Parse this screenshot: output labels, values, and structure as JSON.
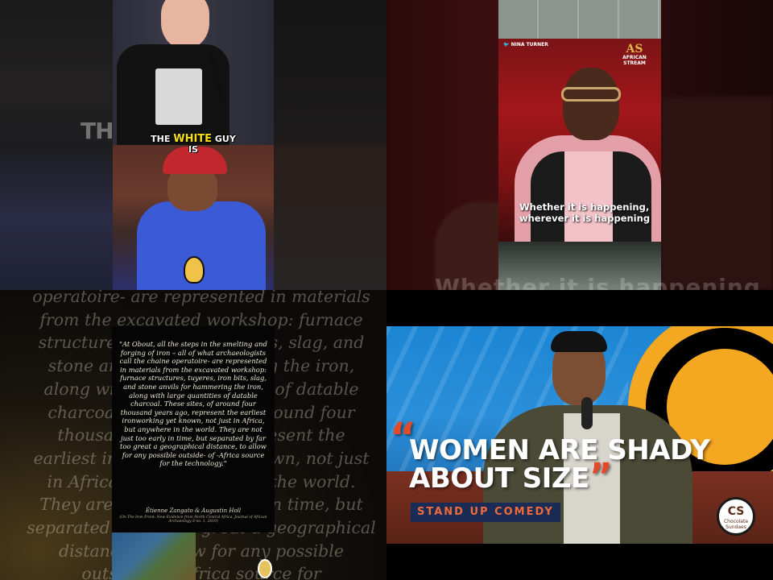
{
  "top_left": {
    "ghost_text": "THE WHITE GUY",
    "caption_line1_pre": "THE",
    "caption_highlight": "WHITE",
    "caption_line1_post": "GUY",
    "caption_line2": "IS"
  },
  "top_right": {
    "credit": "NINA TURNER",
    "logo_mark": "AS",
    "logo_line1": "AFRICAN",
    "logo_line2": "STREAM",
    "caption": "Whether it is happening, wherever it is happening",
    "ghost_caption": "Whether it is happening"
  },
  "bottom_left": {
    "ghost_text": "operatoire- are represented in materials from the excavated workshop: furnace structures, tuyeres, iron bits, slag, and stone anvils for hammering the iron, along with large quantities of datable charcoal. These sites, of around four thousand years ago, represent the earliest ironworking yet known, not just in Africa, but anywhere in the world. They are not just too early in time, but separated by far too great a geographical distance, to allow for any possible outside- of -Africa source for",
    "quote": "\"At Obout, all the steps in the smelting and forging of iron – all of what archaeologists call the chaine operatoire- are represented in materials from the excavated workshop: furnace structures, tuyeres, iron bits, slag, and stone anvils for hammering the iron, along with large quantities of datable charcoal. These sites, of around four thousand years ago, represent the earliest ironworking yet known, not just in Africa, but anywhere in the world. They are not just too early in time, but separated by far too great a geographical distance, to allow for any possible outside- of -Africa source for the technology.\"",
    "author": "Étienne Zangato & Augustin Holl",
    "source": "(On The Iron Front: New Evidence from North-Central Africa. Journal of African Archaeology 8 no. 1, 2010)"
  },
  "bottom_right": {
    "title_open_quote": "“",
    "title_line1": "WOMEN ARE SHADY",
    "title_line2": "ABOUT SIZE",
    "title_close_quote": "”",
    "badge": "STAND UP COMEDY",
    "logo_cs": "CS",
    "logo_sub": "Chocolate Sundaes"
  },
  "colors": {
    "caption_highlight": "#f5e11a",
    "title_quote": "#e24a2a",
    "badge_bg": "#1a2b55",
    "badge_text": "#f06a3a",
    "sign_orange": "#f4a721",
    "stage_blue": "#1c86d4",
    "nina_bg_red": "#a3171b"
  }
}
